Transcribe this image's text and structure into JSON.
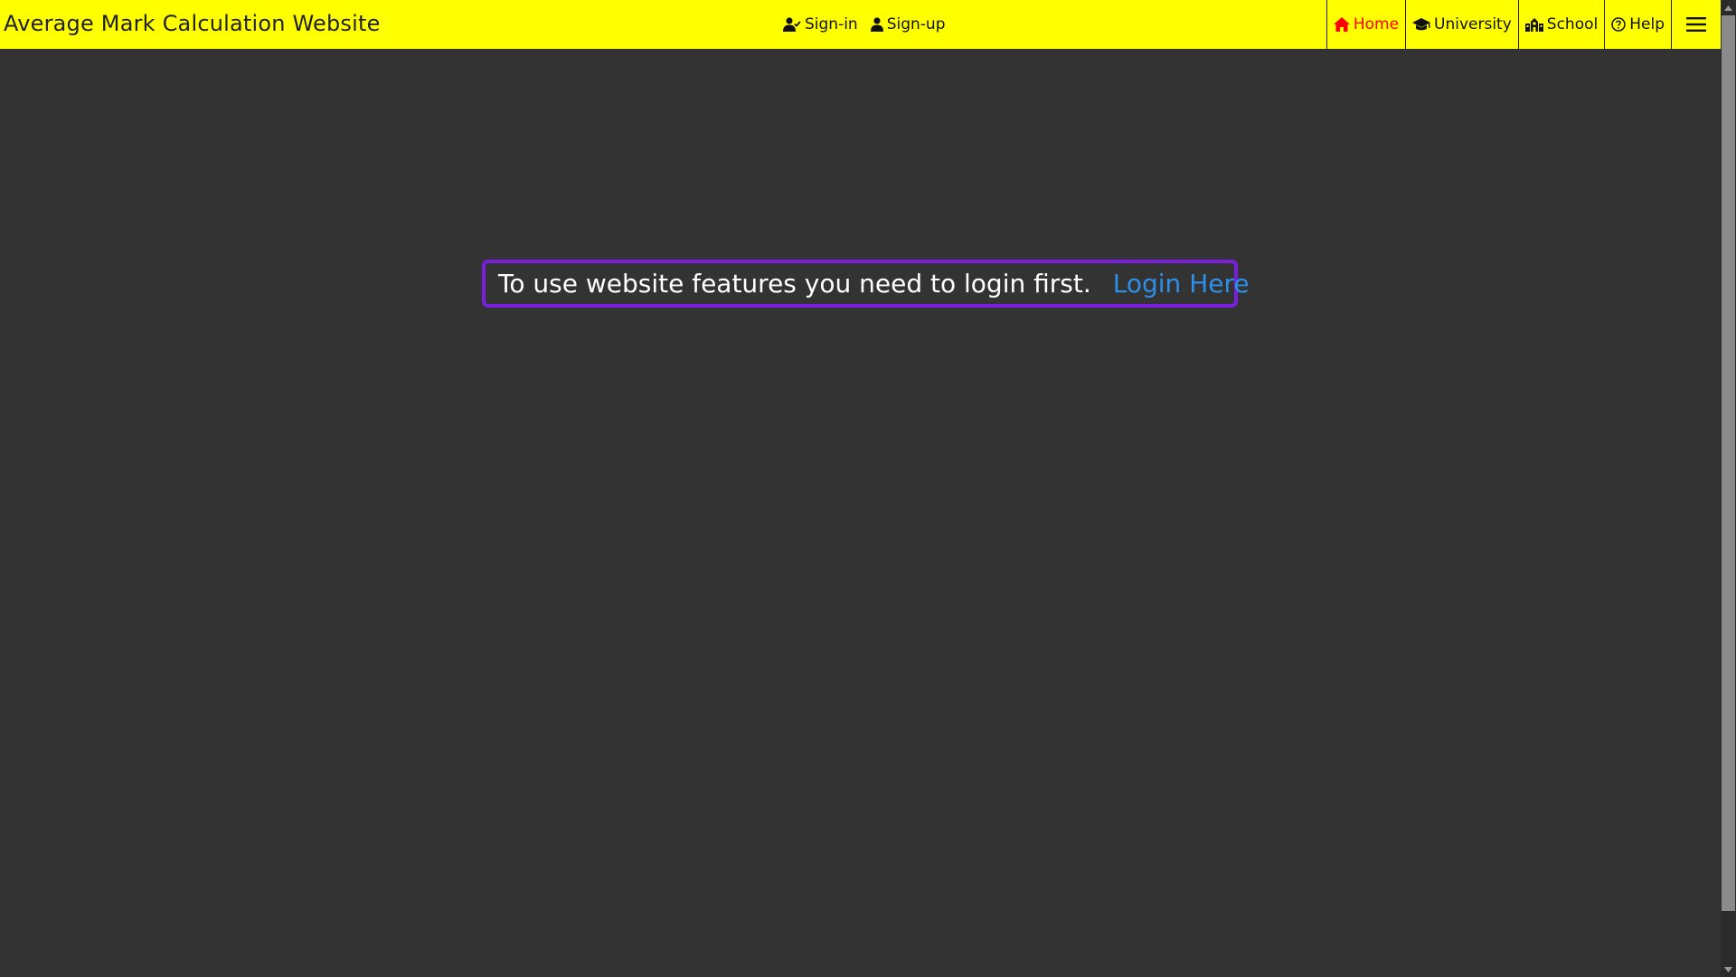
{
  "header": {
    "title": "Average Mark Calculation Website",
    "auth": {
      "signin": {
        "label": "Sign-in",
        "icon": "user-check-icon"
      },
      "signup": {
        "label": "Sign-up",
        "icon": "user-icon"
      }
    },
    "nav": [
      {
        "label": "Home",
        "icon": "home-icon",
        "active": true
      },
      {
        "label": "University",
        "icon": "graduation-cap-icon",
        "active": false
      },
      {
        "label": "School",
        "icon": "school-icon",
        "active": false
      },
      {
        "label": "Help",
        "icon": "help-circle-icon",
        "active": false
      }
    ],
    "menu_icon": "hamburger-menu-icon"
  },
  "notice": {
    "text": "To use website features you need to login first.",
    "link_label": "Login Here"
  },
  "colors": {
    "header_bg": "#ffff00",
    "page_bg": "#333333",
    "active_nav": "#ff0000",
    "notice_border": "#7a1fe0",
    "link": "#2e8fe8"
  }
}
